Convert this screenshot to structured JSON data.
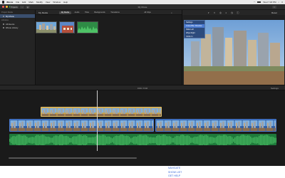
{
  "menubar": {
    "app_name": "iMovie",
    "items": [
      "File",
      "Edit",
      "Mark",
      "Modify",
      "View",
      "Window",
      "Help"
    ],
    "clock": "Wed 7:18 PM"
  },
  "toolbar": {
    "media_label": "Media",
    "projects_label": "Projects",
    "window_title": "My Movie",
    "colors": {
      "close": "#ff5f57",
      "minimize": "#febc2e",
      "zoom": "#28c840"
    }
  },
  "library": {
    "heading": "Project Media",
    "items": [
      {
        "label": "My Movie",
        "selected": true
      },
      {
        "label": "All Events",
        "selected": false
      },
      {
        "label": "iMovie Library",
        "selected": false
      }
    ],
    "subheading": "Libraries"
  },
  "browser": {
    "title": "My Media",
    "tabs": [
      {
        "label": "My Media",
        "active": true
      },
      {
        "label": "Audio",
        "active": false
      },
      {
        "label": "Titles",
        "active": false
      },
      {
        "label": "Backgrounds",
        "active": false
      },
      {
        "label": "Transitions",
        "active": false
      }
    ],
    "all_clips_label": "All Clips",
    "search_icon": "search-icon"
  },
  "viewer": {
    "popup_items": [
      {
        "label": "Settings",
        "selected": false
      },
      {
        "label": "Cross Blur Dissolve",
        "selected": true
      },
      {
        "label": "Slide Left",
        "selected": false
      },
      {
        "label": "Wipe Right",
        "selected": false
      },
      {
        "label": "Circle In",
        "selected": false
      }
    ],
    "reset_label": "Reset",
    "controls": {
      "prev": "⏮",
      "play": "▶",
      "next": "⏭"
    }
  },
  "timeline": {
    "timecode": "0:00 / 0:32",
    "settings_label": "Settings"
  },
  "links": [
    "NAVIGATE",
    "SHOW LIST",
    "GET HELP"
  ]
}
